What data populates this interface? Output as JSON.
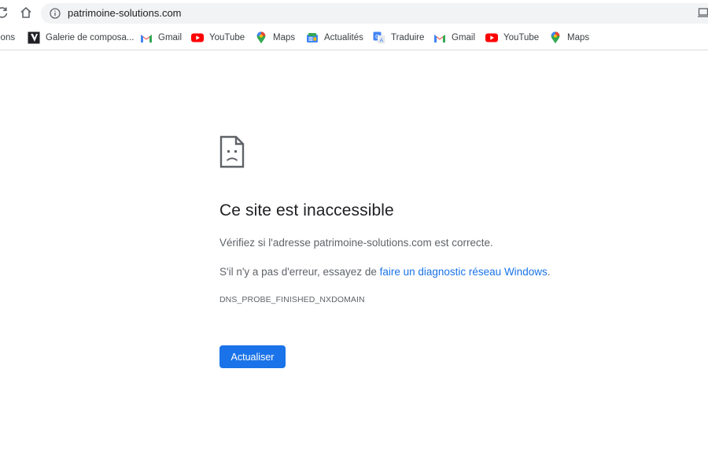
{
  "toolbar": {
    "url": "patrimoine-solutions.com"
  },
  "bookmarks": [
    {
      "label": "ions",
      "icon": "bookmark-partial-icon"
    },
    {
      "label": "Galerie de composa...",
      "icon": "galerie-icon"
    },
    {
      "label": "Gmail",
      "icon": "gmail-icon"
    },
    {
      "label": "YouTube",
      "icon": "youtube-icon"
    },
    {
      "label": "Maps",
      "icon": "maps-icon"
    },
    {
      "label": "Actualités",
      "icon": "news-icon"
    },
    {
      "label": "Traduire",
      "icon": "translate-icon"
    },
    {
      "label": "Gmail",
      "icon": "gmail-icon"
    },
    {
      "label": "YouTube",
      "icon": "youtube-icon"
    },
    {
      "label": "Maps",
      "icon": "maps-icon"
    }
  ],
  "error": {
    "title": "Ce site est inaccessible",
    "line1": "Vérifiez si l'adresse patrimoine-solutions.com est correcte.",
    "line2_prefix": "S'il n'y a pas d'erreur, essayez de ",
    "line2_link": "faire un diagnostic réseau Windows",
    "line2_suffix": ".",
    "code": "DNS_PROBE_FINISHED_NXDOMAIN",
    "button": "Actualiser"
  },
  "colors": {
    "accent": "#1a73e8",
    "text": "#202124",
    "secondary_text": "#5f6368",
    "omnibox": "#f1f3f4"
  }
}
